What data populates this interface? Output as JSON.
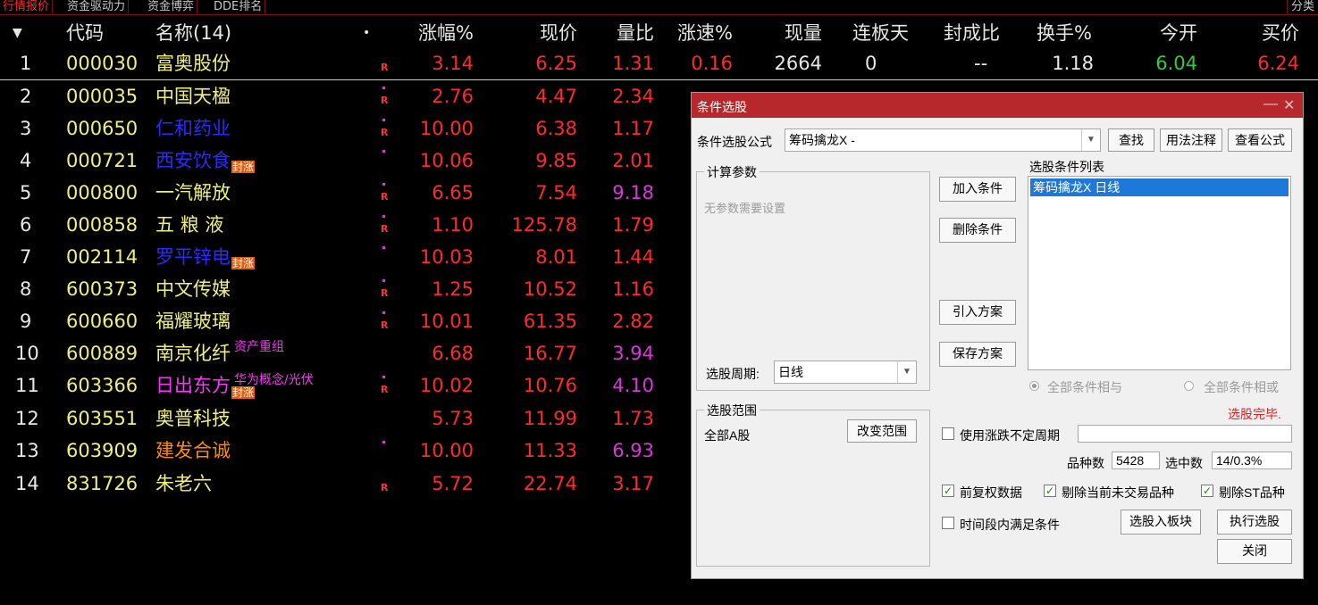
{
  "tabs": [
    "行情报价",
    "资金驱动力",
    "资金博弈",
    "DDE排名"
  ],
  "tab_right": "分类",
  "headers": {
    "sort": "▼",
    "code": "代码",
    "name": "名称(14)",
    "dot": "•",
    "change_pct": "涨幅%",
    "price": "现价",
    "vol_ratio": "量比",
    "speed": "涨速%",
    "cur_vol": "现量",
    "limit_days": "连板天",
    "seal_ratio": "封成比",
    "turnover": "换手%",
    "open": "今开",
    "bid": "买价"
  },
  "rows": [
    {
      "no": "1",
      "code": "000030",
      "name": "富奥股份",
      "chg": "3.14",
      "price": "6.25",
      "vr": "1.31",
      "speed": "0.16",
      "vol": "2664",
      "days": "0",
      "seal": "--",
      "turn": "1.18",
      "open": "6.04",
      "bid": "6.24"
    },
    {
      "no": "2",
      "code": "000035",
      "name": "中国天楹",
      "chg": "2.76",
      "price": "4.47",
      "vr": "2.34"
    },
    {
      "no": "3",
      "code": "000650",
      "name": "仁和药业",
      "chg": "10.00",
      "price": "6.38",
      "vr": "1.17"
    },
    {
      "no": "4",
      "code": "000721",
      "name": "西安饮食",
      "chg": "10.06",
      "price": "9.85",
      "vr": "2.01",
      "badge": "封涨"
    },
    {
      "no": "5",
      "code": "000800",
      "name": "一汽解放",
      "chg": "6.65",
      "price": "7.54",
      "vr": "9.18"
    },
    {
      "no": "6",
      "code": "000858",
      "name": "五 粮 液",
      "chg": "1.10",
      "price": "125.78",
      "vr": "1.79"
    },
    {
      "no": "7",
      "code": "002114",
      "name": "罗平锌电",
      "chg": "10.03",
      "price": "8.01",
      "vr": "1.44",
      "badge": "封涨"
    },
    {
      "no": "8",
      "code": "600373",
      "name": "中文传媒",
      "chg": "1.25",
      "price": "10.52",
      "vr": "1.16"
    },
    {
      "no": "9",
      "code": "600660",
      "name": "福耀玻璃",
      "chg": "10.01",
      "price": "61.35",
      "vr": "2.82"
    },
    {
      "no": "10",
      "code": "600889",
      "name": "南京化纤",
      "chg": "6.68",
      "price": "16.77",
      "vr": "3.94",
      "note": "资产重组"
    },
    {
      "no": "11",
      "code": "603366",
      "name": "日出东方",
      "chg": "10.02",
      "price": "10.76",
      "vr": "4.10",
      "note": "华为概念/光伏",
      "badge": "封涨"
    },
    {
      "no": "12",
      "code": "603551",
      "name": "奥普科技",
      "chg": "5.73",
      "price": "11.99",
      "vr": "1.73"
    },
    {
      "no": "13",
      "code": "603909",
      "name": "建发合诚",
      "chg": "10.00",
      "price": "11.33",
      "vr": "6.93"
    },
    {
      "no": "14",
      "code": "831726",
      "name": "朱老六",
      "chg": "5.72",
      "price": "22.74",
      "vr": "3.17"
    }
  ],
  "r_tag": "R",
  "dialog": {
    "title": "条件选股",
    "min_glyph": "—",
    "close_glyph": "✕",
    "formula_label": "条件选股公式",
    "formula_value": "筹码擒龙X  -",
    "find_btn": "查找",
    "usage_btn": "用法注释",
    "view_btn": "查看公式",
    "params_caption": "计算参数",
    "no_params": "无参数需要设置",
    "period_label": "选股周期:",
    "period_value": "日线",
    "add_btn": "加入条件",
    "del_btn": "删除条件",
    "import_btn": "引入方案",
    "save_btn": "保存方案",
    "list_caption": "选股条件列表",
    "list_item": "筹码擒龙X  日线",
    "radio_and": "全部条件相与",
    "radio_or": "全部条件相或",
    "status": "选股完毕.",
    "range_caption": "选股范围",
    "range_value": "全部A股",
    "change_range_btn": "改变范围",
    "use_period_label": "使用涨跌不定周期",
    "count_label": "品种数",
    "count_value": "5428",
    "selected_label": "选中数",
    "selected_value": "14/0.3%",
    "fq_label": "前复权数据",
    "exclude_untraded_label": "剔除当前未交易品种",
    "exclude_st_label": "剔除ST品种",
    "period_cond_label": "时间段内满足条件",
    "to_block_btn": "选股入板块",
    "exec_btn": "执行选股",
    "close_btn": "关闭",
    "check_glyph": "✓"
  }
}
